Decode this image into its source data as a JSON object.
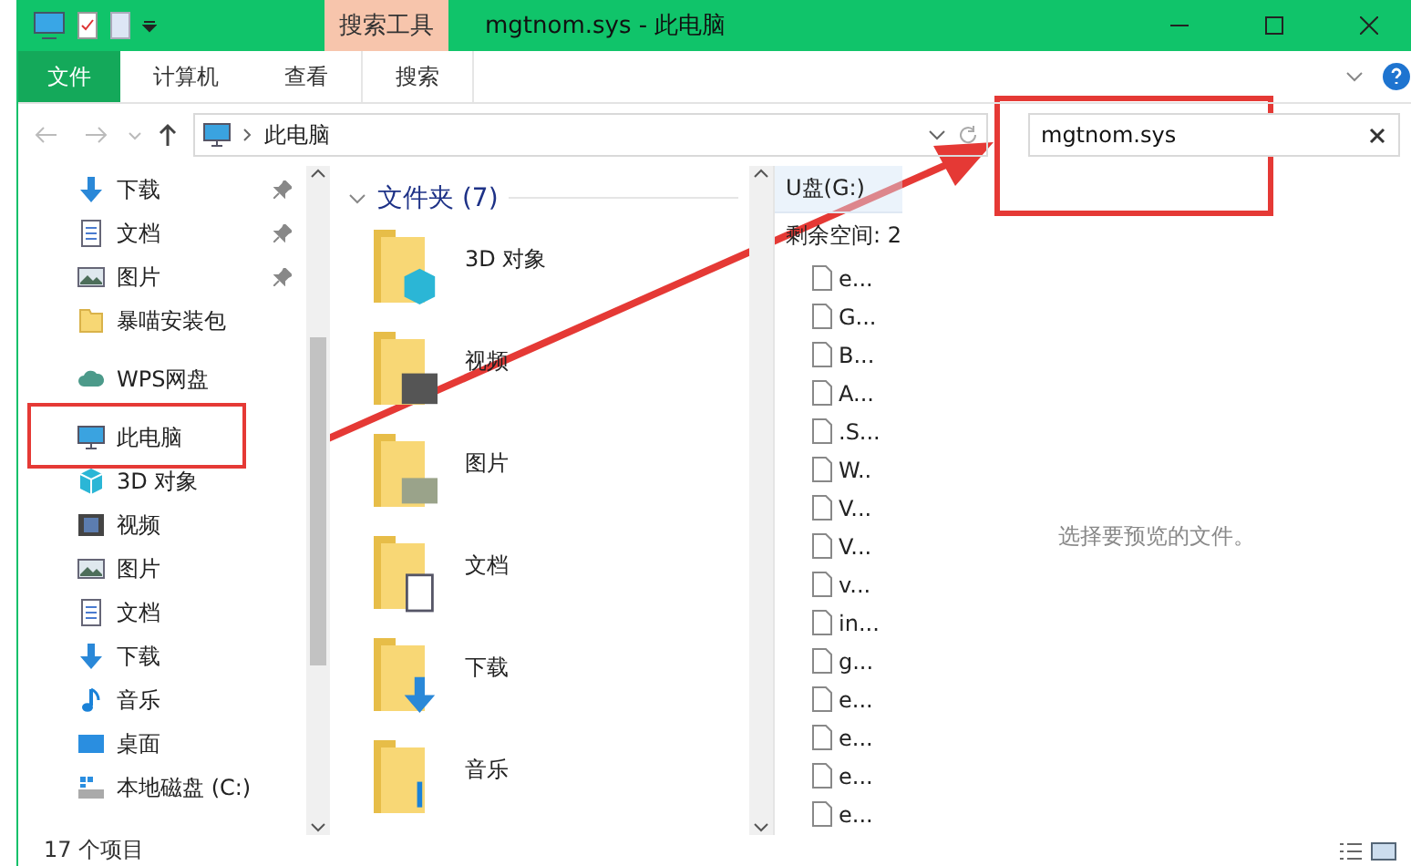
{
  "window": {
    "title": "mgtnom.sys - 此电脑",
    "context_tab": "搜索工具"
  },
  "ribbon_tabs": [
    {
      "label": "文件",
      "kind": "file"
    },
    {
      "label": "计算机",
      "kind": "tab"
    },
    {
      "label": "查看",
      "kind": "tab"
    },
    {
      "label": "搜索",
      "kind": "context"
    }
  ],
  "address": {
    "path": "此电脑"
  },
  "search": {
    "value": "mgtnom.sys"
  },
  "sidebar": {
    "groups": [
      {
        "items": [
          {
            "label": "下载",
            "kind": "download",
            "pinned": true
          },
          {
            "label": "文档",
            "kind": "document",
            "pinned": true
          },
          {
            "label": "图片",
            "kind": "picture",
            "pinned": true
          },
          {
            "label": "暴喵安装包",
            "kind": "folder",
            "pinned": false
          }
        ]
      },
      {
        "items": [
          {
            "label": "WPS网盘",
            "kind": "cloud",
            "pinned": false
          }
        ]
      },
      {
        "items": [
          {
            "label": "此电脑",
            "kind": "pc",
            "pinned": false
          },
          {
            "label": "3D 对象",
            "kind": "cube",
            "pinned": false
          },
          {
            "label": "视频",
            "kind": "video",
            "pinned": false
          },
          {
            "label": "图片",
            "kind": "picture",
            "pinned": false
          },
          {
            "label": "文档",
            "kind": "document",
            "pinned": false
          },
          {
            "label": "下载",
            "kind": "download",
            "pinned": false
          },
          {
            "label": "音乐",
            "kind": "music",
            "pinned": false
          },
          {
            "label": "桌面",
            "kind": "desktop",
            "pinned": false
          },
          {
            "label": "本地磁盘 (C:)",
            "kind": "drive",
            "pinned": false
          }
        ]
      }
    ]
  },
  "content": {
    "group": "文件夹 (7)",
    "folders": [
      {
        "label": "3D 对象",
        "kind": "cube"
      },
      {
        "label": "视频",
        "kind": "video"
      },
      {
        "label": "图片",
        "kind": "picture"
      },
      {
        "label": "文档",
        "kind": "document"
      },
      {
        "label": "下载",
        "kind": "download"
      },
      {
        "label": "音乐",
        "kind": "music"
      }
    ]
  },
  "drive_pane": {
    "title": "U盘(G:)",
    "free_space": "剩余空间: 2",
    "files": [
      "e...",
      "G...",
      "B...",
      "A...",
      ".S...",
      "W..",
      "V...",
      "V...",
      "v...",
      "in...",
      "g...",
      "e...",
      "e...",
      "e...",
      "e..."
    ]
  },
  "preview": {
    "message": "选择要预览的文件。"
  },
  "status_bar": {
    "count": "17 个项目"
  }
}
